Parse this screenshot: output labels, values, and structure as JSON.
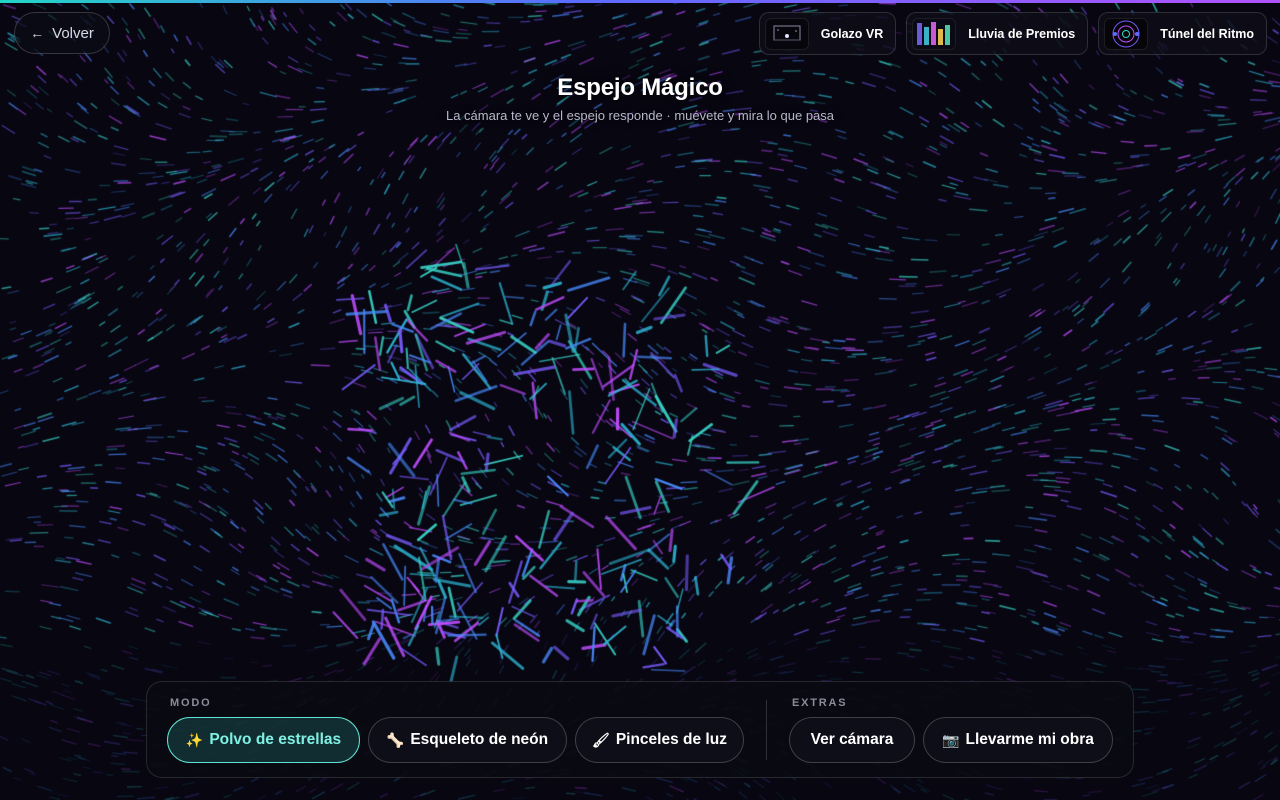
{
  "header": {
    "back_label": "Volver",
    "back_icon": "←",
    "title": "Espejo Mágico",
    "subtitle": "La cámara te ve y el espejo responde · muévete y mira lo que pasa"
  },
  "experiences": [
    {
      "label": "Golazo VR",
      "thumb": "goal-thumbnail"
    },
    {
      "label": "Lluvia de Premios",
      "thumb": "prizes-thumbnail"
    },
    {
      "label": "Túnel del Ritmo",
      "thumb": "tunnel-thumbnail"
    }
  ],
  "controls": {
    "mode_label": "MODO",
    "modes": [
      {
        "icon": "✨",
        "label": "Polvo de estrellas",
        "active": true
      },
      {
        "icon": "🦴",
        "label": "Esqueleto de neón",
        "active": false
      },
      {
        "icon": "🖌",
        "label": "Pinceles de luz",
        "active": false
      }
    ],
    "extras_label": "EXTRAS",
    "extras": [
      {
        "icon": "",
        "label": "Ver cámara"
      },
      {
        "icon": "📷",
        "label": "Llevarme mi obra"
      }
    ]
  },
  "colors": {
    "background": "#070611",
    "accent": "#5fe3d3",
    "particle_palette": [
      "#3ad6c8",
      "#7a5cff",
      "#c14dff",
      "#4a8cff",
      "#2fb8d6"
    ]
  }
}
